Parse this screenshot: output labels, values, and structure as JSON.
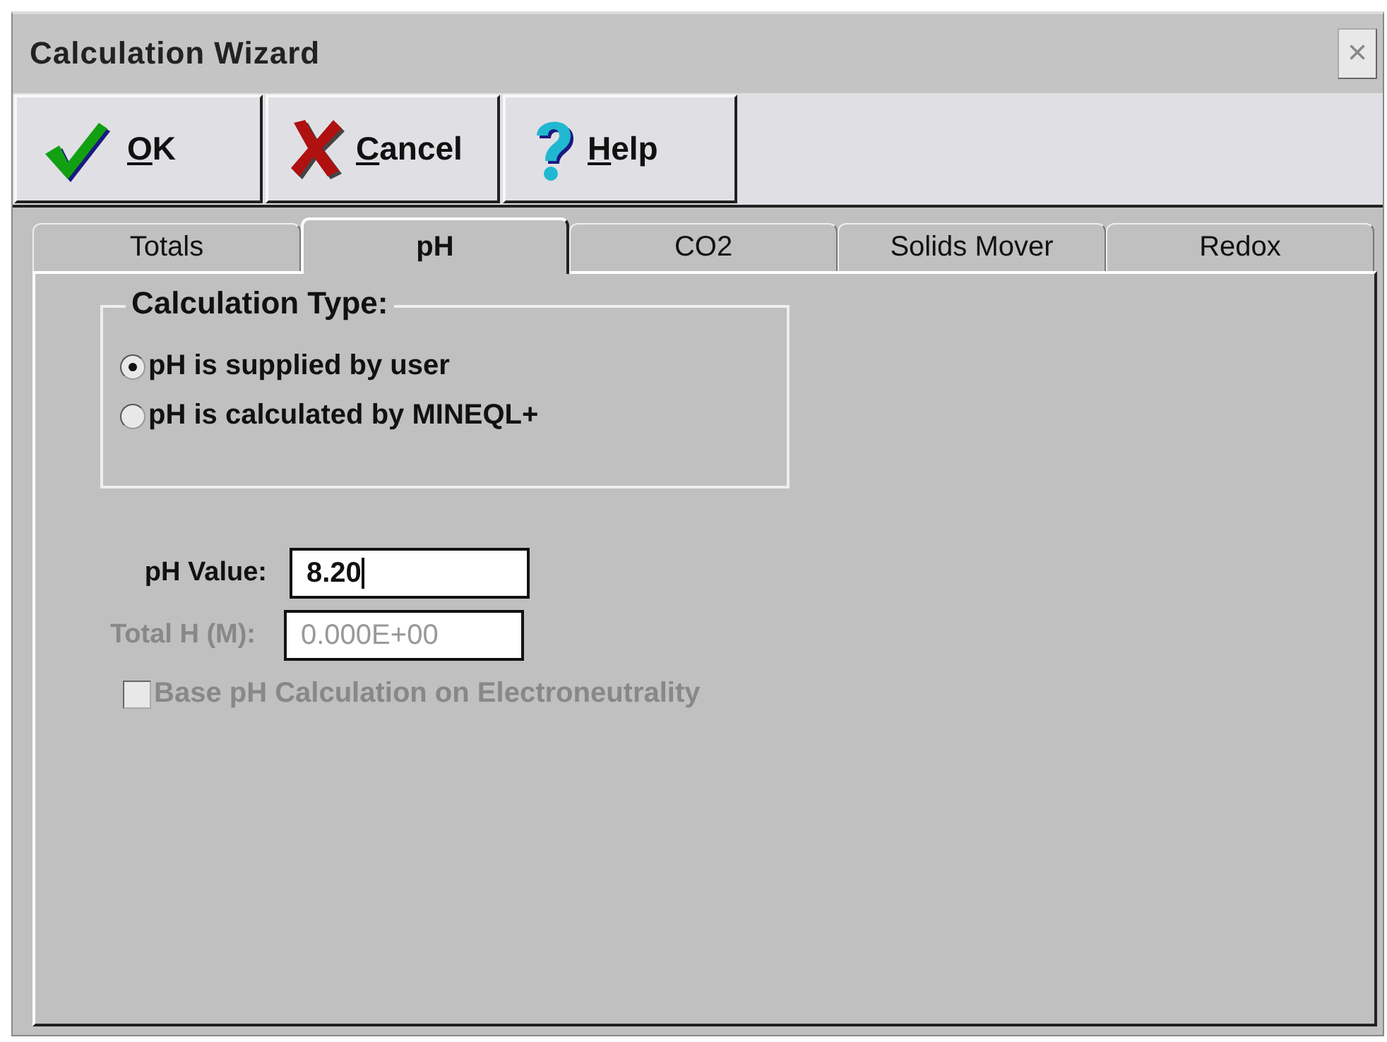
{
  "window": {
    "title": "Calculation Wizard",
    "close": "×"
  },
  "buttons": [
    {
      "kind": "ok",
      "accel": "O",
      "label": "K"
    },
    {
      "kind": "cancel",
      "accel": "C",
      "label": "ancel"
    },
    {
      "kind": "help",
      "accel": "H",
      "label": "elp"
    }
  ],
  "tabs": [
    {
      "label": "Totals",
      "selected": false
    },
    {
      "label": "pH",
      "selected": true
    },
    {
      "label": "CO2",
      "selected": false
    },
    {
      "label": "Solids Mover",
      "selected": false
    },
    {
      "label": "Redox",
      "selected": false
    }
  ],
  "calculation_type": {
    "title": "Calculation Type:",
    "options": [
      {
        "label": "pH is supplied by user",
        "selected": true
      },
      {
        "label": "pH is calculated by MINEQL+",
        "selected": false
      }
    ]
  },
  "fields": [
    {
      "label": "pH Value:",
      "value": "8.20",
      "disabled": false,
      "focused": true
    },
    {
      "label": "Total H (M):",
      "value": "0.000E+00",
      "disabled": true,
      "focused": false
    }
  ],
  "checkbox": {
    "label": "Base pH Calculation on Electroneutrality",
    "checked": false,
    "disabled": true
  }
}
